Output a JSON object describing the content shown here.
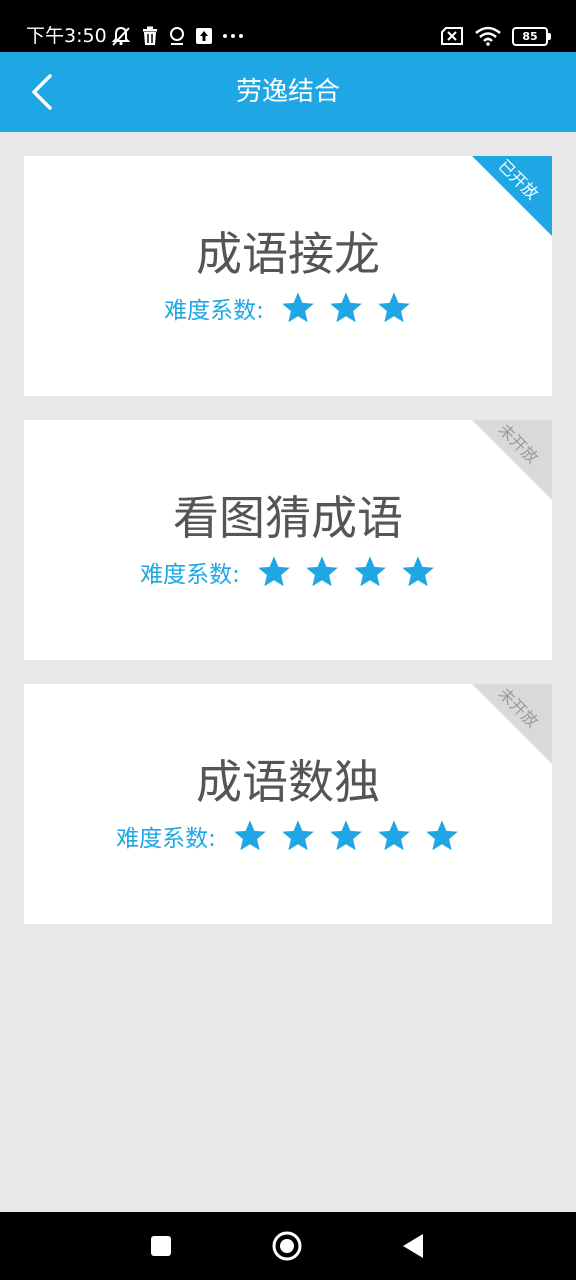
{
  "status_bar": {
    "time": "下午3:50",
    "battery": "85",
    "icons_left": [
      "mute-bell-icon",
      "trash-icon",
      "location-icon",
      "upload-icon",
      "more-icon"
    ],
    "icons_right": [
      "no-sim-icon",
      "wifi-icon",
      "battery-icon"
    ]
  },
  "header": {
    "title": "劳逸结合",
    "back_icon": "chevron-left-icon"
  },
  "games": [
    {
      "title": "成语接龙",
      "difficulty_label": "难度系数:",
      "stars": 3,
      "status": "已开放"
    },
    {
      "title": "看图猜成语",
      "difficulty_label": "难度系数:",
      "stars": 4,
      "status": "未开放"
    },
    {
      "title": "成语数独",
      "difficulty_label": "难度系数:",
      "stars": 5,
      "status": "未开放"
    }
  ],
  "nav_bar": {
    "buttons": [
      "recent-apps-icon",
      "home-icon",
      "back-icon"
    ]
  },
  "colors": {
    "accent": "#1ea7e4",
    "closed_ribbon": "#d9d9d9",
    "background": "#e8e8e8",
    "title_text": "#555555"
  }
}
